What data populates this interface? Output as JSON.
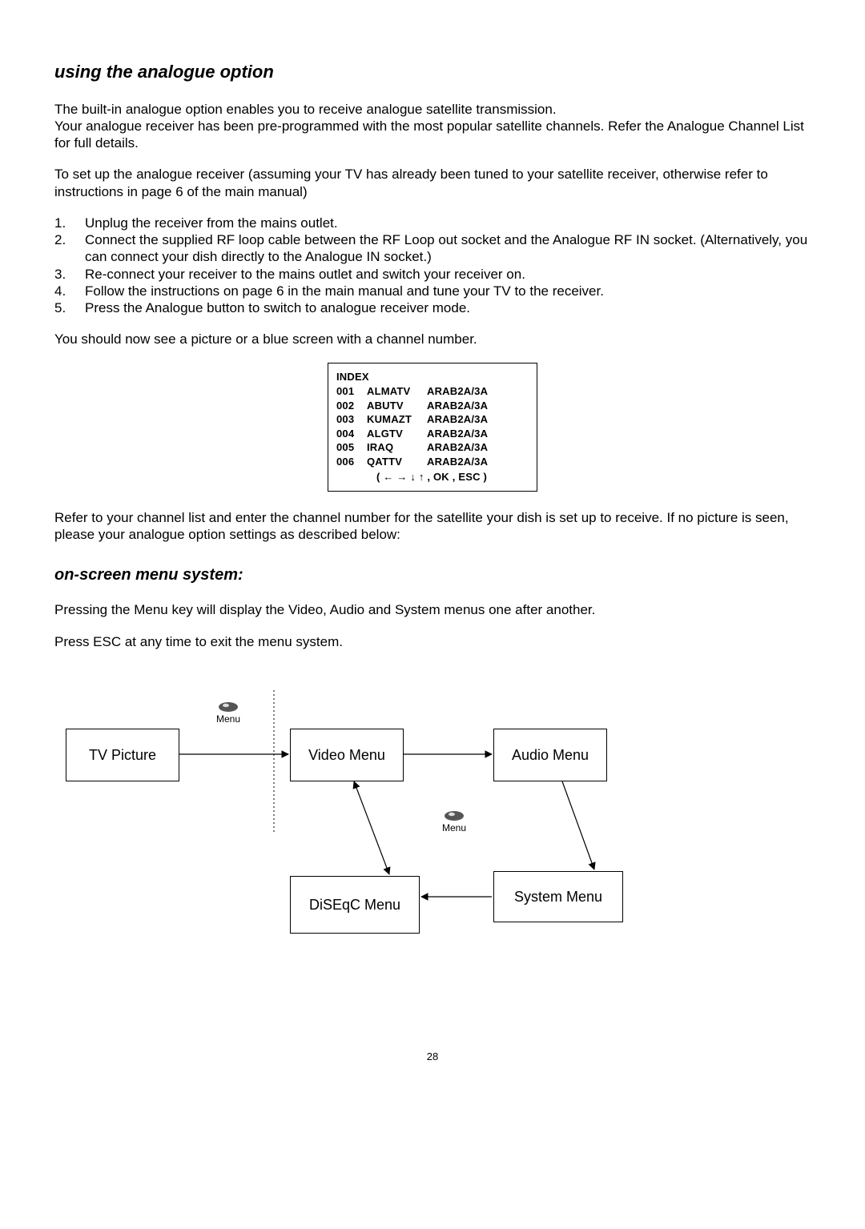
{
  "headings": {
    "main": "using the analogue option",
    "sub": "on-screen menu system:"
  },
  "paragraphs": {
    "intro": "The built-in analogue option enables you to receive analogue satellite transmission.\nYour analogue receiver has been pre-programmed with the most popular satellite channels. Refer the Analogue Channel List for full details.",
    "setup": "To set up the analogue receiver (assuming your TV has already been tuned to your satellite receiver, otherwise refer to instructions in page 6 of the main manual)",
    "after_list": "You should now see a picture or a blue screen with a channel number.",
    "refer": "Refer to your channel list and enter the channel number for the satellite your dish is set up to receive. If no picture is seen, please your analogue option settings as described below:",
    "menu1": "Pressing the Menu key will display the Video, Audio and System menus one after another.",
    "menu2": "Press ESC at any time to exit the menu system."
  },
  "steps": [
    "Unplug the receiver from the mains outlet.",
    "Connect the supplied RF loop cable between the RF Loop out socket and the Analogue RF IN socket. (Alternatively, you can connect your dish directly to the Analogue IN socket.)",
    "Re-connect your receiver to the mains outlet and switch your receiver on.",
    "Follow the instructions on page 6 in the main manual and tune your TV to the receiver.",
    "Press the Analogue button to switch to analogue receiver mode."
  ],
  "index": {
    "title": "INDEX",
    "rows": [
      {
        "num": "001",
        "name": "ALMATV",
        "sat": "ARAB2A/3A"
      },
      {
        "num": "002",
        "name": "ABUTV",
        "sat": "ARAB2A/3A"
      },
      {
        "num": "003",
        "name": "KUMAZT",
        "sat": "ARAB2A/3A"
      },
      {
        "num": "004",
        "name": "ALGTV",
        "sat": "ARAB2A/3A"
      },
      {
        "num": "005",
        "name": "IRAQ",
        "sat": "ARAB2A/3A"
      },
      {
        "num": "006",
        "name": "QATTV",
        "sat": "ARAB2A/3A"
      }
    ],
    "footer": "( ← → ↓ ↑  , OK , ESC )"
  },
  "diagram": {
    "boxes": {
      "tv": "TV Picture",
      "video": "Video Menu",
      "audio": "Audio Menu",
      "diseqc": "DiSEqC Menu",
      "system": "System Menu"
    },
    "menu_label": "Menu"
  },
  "page_number": "28"
}
